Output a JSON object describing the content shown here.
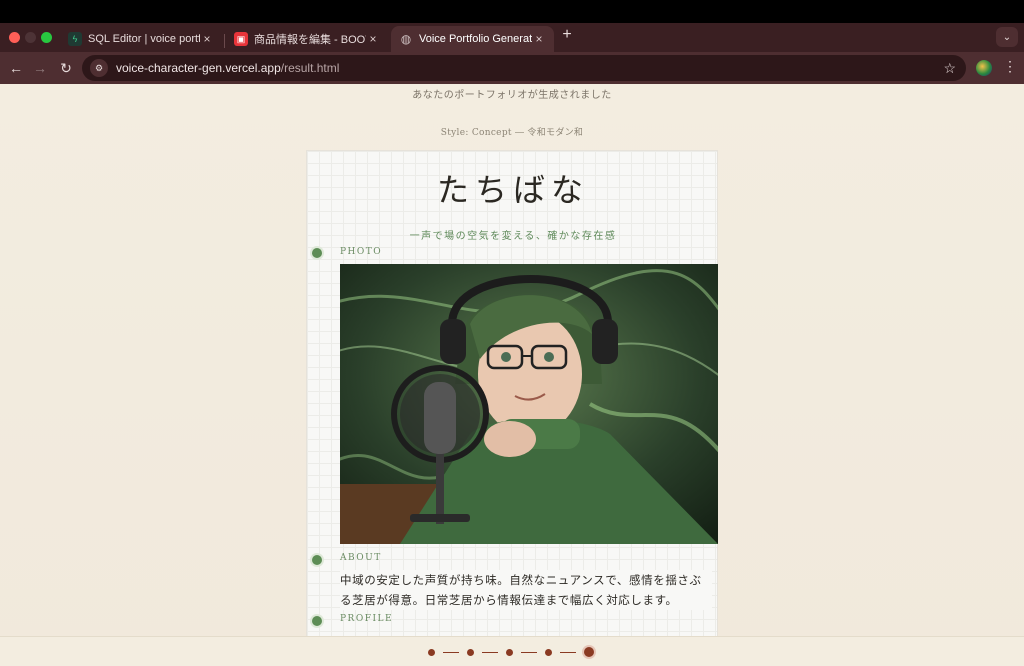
{
  "browser": {
    "tabs": [
      {
        "title": "SQL Editor | voice portfolio | ",
        "favicon": "supabase-icon",
        "close": "×"
      },
      {
        "title": "商品情報を編集 - BOOTH",
        "favicon": "booth-icon",
        "close": "×"
      },
      {
        "title": "Voice Portfolio Generator — ",
        "favicon": "globe-icon",
        "close": "×",
        "active": true
      }
    ],
    "new_tab": "+",
    "tab_menu": "⌄",
    "url_host": "voice-character-gen.vercel.app",
    "url_path": "/result.html",
    "bookmark": "☆",
    "menu": "⋮"
  },
  "page": {
    "status_message": "あなたのポートフォリオが生成されました",
    "style_label": "Style: Concept ― 令和モダン和",
    "character_name": "たちばな",
    "tagline": "一声で場の空気を変える、確かな存在感",
    "sections": {
      "photo": "PHOTO",
      "about": "ABOUT",
      "profile": "PROFILE"
    },
    "about_text": "中域の安定した声質が持ち味。自然なニュアンスで、感情を揺さぶる芝居が得意。日常芝居から情報伝達まで幅広く対応します。",
    "pager": {
      "count": 5,
      "active_index": 4
    }
  },
  "colors": {
    "accent_green": "#5d8d55",
    "pager_red": "#8a3a22",
    "tab_bg": "#3a1f22"
  }
}
